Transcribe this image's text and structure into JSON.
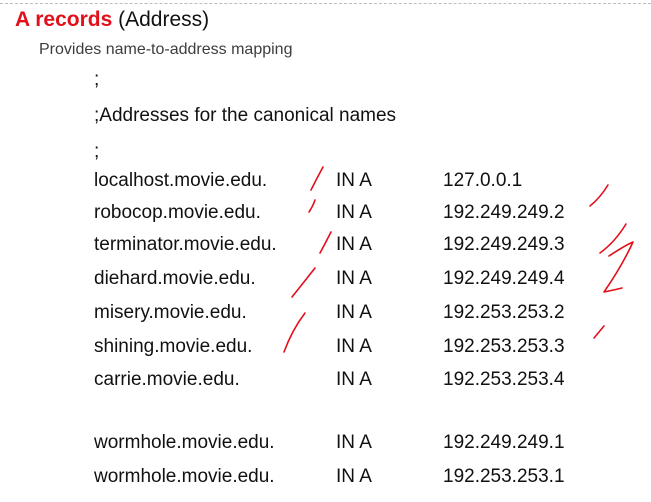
{
  "slide": {
    "title_accent": "A records",
    "title_rest": " (Address)",
    "subtitle": "Provides name-to-address mapping"
  },
  "zone_file": {
    "comment_1": ";",
    "comment_2": ";Addresses for the canonical names",
    "comment_3": ";",
    "records": [
      {
        "host": "localhost.movie.edu.",
        "type": "IN A",
        "address": "127.0.0.1"
      },
      {
        "host": "robocop.movie.edu.",
        "type": "IN A",
        "address": "192.249.249.2"
      },
      {
        "host": "terminator.movie.edu.",
        "type": "IN A",
        "address": "192.249.249.3"
      },
      {
        "host": "diehard.movie.edu.",
        "type": "IN A",
        "address": "192.249.249.4"
      },
      {
        "host": "misery.movie.edu.",
        "type": "IN A",
        "address": "192.253.253.2"
      },
      {
        "host": "shining.movie.edu.",
        "type": "IN A",
        "address": "192.253.253.3"
      },
      {
        "host": "carrie.movie.edu.",
        "type": "IN A",
        "address": "192.253.253.4"
      },
      {
        "host": "wormhole.movie.edu.",
        "type": "IN A",
        "address": "192.249.249.1"
      },
      {
        "host": "wormhole.movie.edu.",
        "type": "IN A",
        "address": "192.253.253.1"
      }
    ]
  },
  "colors": {
    "accent": "#e3101b",
    "annotation_ink": "#e3101b",
    "text": "#111111",
    "subtitle_text": "#3d3d3d"
  }
}
